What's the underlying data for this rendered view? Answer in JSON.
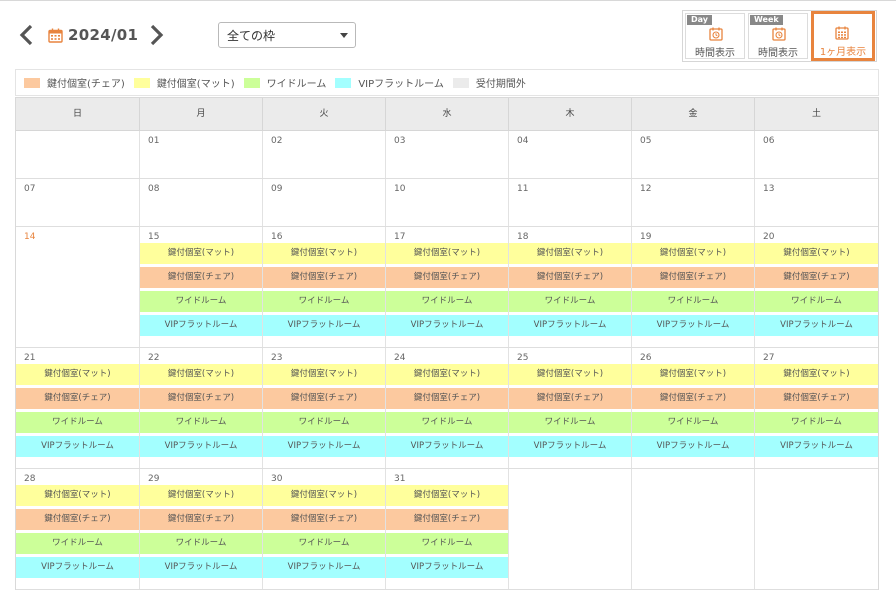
{
  "header": {
    "month_label": "2024/01",
    "filter_select": "全ての枠"
  },
  "views": [
    {
      "tag": "Day",
      "label": "時間表示",
      "icon": "clock-icon"
    },
    {
      "tag": "Week",
      "label": "時間表示",
      "icon": "clock-icon"
    },
    {
      "tag": "",
      "label": "1ヶ月表示",
      "icon": "calendar-icon",
      "active": true
    }
  ],
  "legend": [
    {
      "label": "鍵付個室(チェア)",
      "color": "#fcc99f"
    },
    {
      "label": "鍵付個室(マット)",
      "color": "#ffff9c"
    },
    {
      "label": "ワイドルーム",
      "color": "#ccff99"
    },
    {
      "label": "VIPフラットルーム",
      "color": "#a3ffff"
    },
    {
      "label": "受付期間外",
      "color": "#ebebeb"
    }
  ],
  "weekdays": [
    "日",
    "月",
    "火",
    "水",
    "木",
    "金",
    "土"
  ],
  "slot_types": {
    "mat": {
      "label": "鍵付個室(マット)",
      "color": "#ffff9c"
    },
    "chair": {
      "label": "鍵付個室(チェア)",
      "color": "#fcc99f"
    },
    "wide": {
      "label": "ワイドルーム",
      "color": "#ccff99"
    },
    "vip": {
      "label": "VIPフラットルーム",
      "color": "#a3ffff"
    }
  },
  "weeks": [
    [
      {
        "day": "",
        "slots": []
      },
      {
        "day": "01",
        "slots": []
      },
      {
        "day": "02",
        "slots": []
      },
      {
        "day": "03",
        "slots": []
      },
      {
        "day": "04",
        "slots": []
      },
      {
        "day": "05",
        "slots": []
      },
      {
        "day": "06",
        "slots": []
      }
    ],
    [
      {
        "day": "07",
        "slots": []
      },
      {
        "day": "08",
        "slots": []
      },
      {
        "day": "09",
        "slots": []
      },
      {
        "day": "10",
        "slots": []
      },
      {
        "day": "11",
        "slots": []
      },
      {
        "day": "12",
        "slots": []
      },
      {
        "day": "13",
        "slots": []
      }
    ],
    [
      {
        "day": "14",
        "slots": [],
        "highlight": true
      },
      {
        "day": "15",
        "slots": [
          "mat",
          "chair",
          "wide",
          "vip"
        ]
      },
      {
        "day": "16",
        "slots": [
          "mat",
          "chair",
          "wide",
          "vip"
        ]
      },
      {
        "day": "17",
        "slots": [
          "mat",
          "chair",
          "wide",
          "vip"
        ]
      },
      {
        "day": "18",
        "slots": [
          "mat",
          "chair",
          "wide",
          "vip"
        ]
      },
      {
        "day": "19",
        "slots": [
          "mat",
          "chair",
          "wide",
          "vip"
        ]
      },
      {
        "day": "20",
        "slots": [
          "mat",
          "chair",
          "wide",
          "vip"
        ]
      }
    ],
    [
      {
        "day": "21",
        "slots": [
          "mat",
          "chair",
          "wide",
          "vip"
        ]
      },
      {
        "day": "22",
        "slots": [
          "mat",
          "chair",
          "wide",
          "vip"
        ]
      },
      {
        "day": "23",
        "slots": [
          "mat",
          "chair",
          "wide",
          "vip"
        ]
      },
      {
        "day": "24",
        "slots": [
          "mat",
          "chair",
          "wide",
          "vip"
        ]
      },
      {
        "day": "25",
        "slots": [
          "mat",
          "chair",
          "wide",
          "vip"
        ]
      },
      {
        "day": "26",
        "slots": [
          "mat",
          "chair",
          "wide",
          "vip"
        ]
      },
      {
        "day": "27",
        "slots": [
          "mat",
          "chair",
          "wide",
          "vip"
        ]
      }
    ],
    [
      {
        "day": "28",
        "slots": [
          "mat",
          "chair",
          "wide",
          "vip"
        ]
      },
      {
        "day": "29",
        "slots": [
          "mat",
          "chair",
          "wide",
          "vip"
        ]
      },
      {
        "day": "30",
        "slots": [
          "mat",
          "chair",
          "wide",
          "vip"
        ]
      },
      {
        "day": "31",
        "slots": [
          "mat",
          "chair",
          "wide",
          "vip"
        ]
      },
      {
        "day": "",
        "slots": []
      },
      {
        "day": "",
        "slots": []
      },
      {
        "day": "",
        "slots": []
      }
    ]
  ]
}
